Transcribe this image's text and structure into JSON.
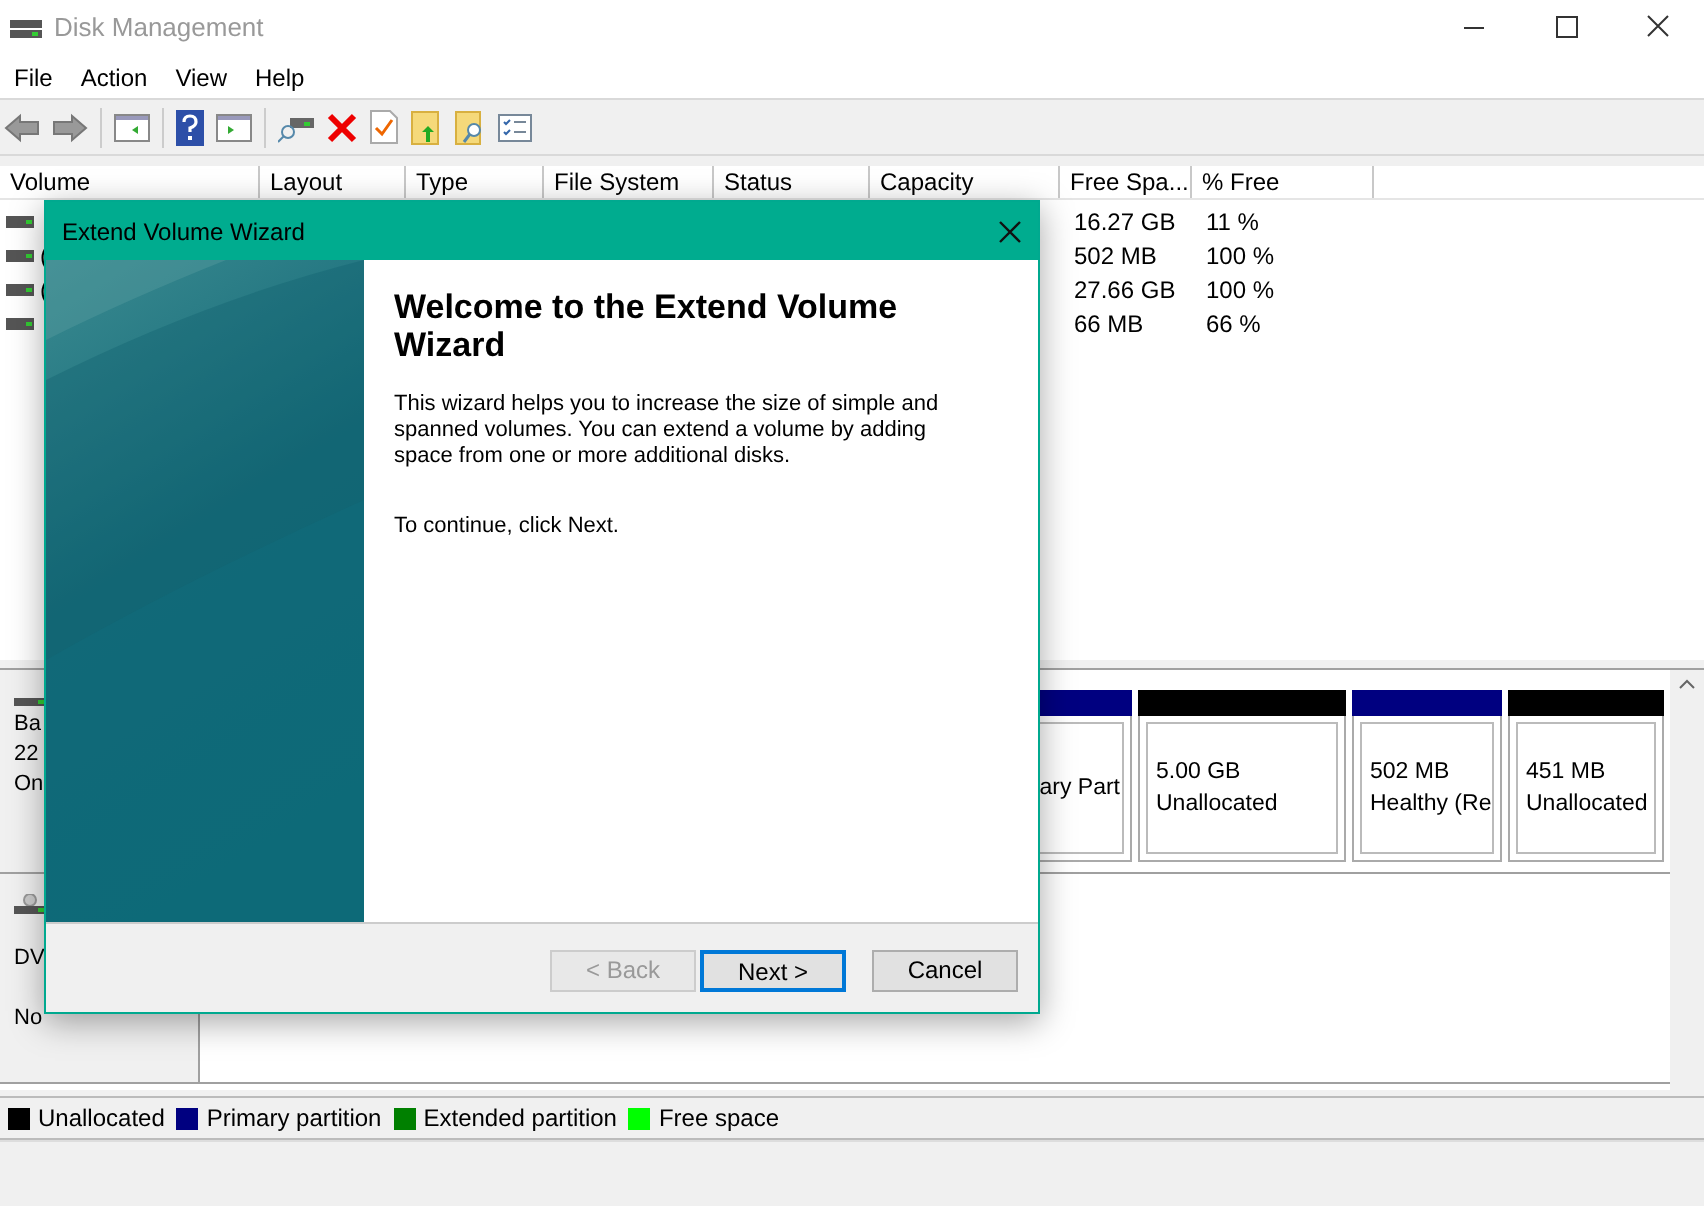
{
  "window": {
    "title": "Disk Management"
  },
  "menu": [
    "File",
    "Action",
    "View",
    "Help"
  ],
  "volumes": {
    "columns": [
      "Volume",
      "Layout",
      "Type",
      "File System",
      "Status",
      "Capacity",
      "Free Spa...",
      "% Free"
    ],
    "rows": [
      {
        "free_space": "16.27 GB",
        "percent_free": "11 %"
      },
      {
        "volume": "(",
        "free_space": "502 MB",
        "percent_free": "100 %"
      },
      {
        "volume": "(",
        "free_space": "27.66 GB",
        "percent_free": "100 %"
      },
      {
        "free_space": "66 MB",
        "percent_free": "66 %"
      }
    ]
  },
  "disks": [
    {
      "kind": "disk",
      "lines": [
        "Ba",
        "22",
        "On"
      ],
      "partitions": [
        {
          "color": "#000080",
          "lines": [
            "ary Part"
          ]
        },
        {
          "color": "#000000",
          "lines": [
            "5.00 GB",
            "Unallocated"
          ]
        },
        {
          "color": "#000080",
          "lines": [
            "502 MB",
            "Healthy (Re"
          ]
        },
        {
          "color": "#000000",
          "lines": [
            "451 MB",
            "Unallocated"
          ]
        }
      ]
    },
    {
      "kind": "cdrom",
      "lines": [
        "DV",
        "No"
      ]
    }
  ],
  "legend": [
    {
      "label": "Unallocated",
      "color": "#000000"
    },
    {
      "label": "Primary partition",
      "color": "#000080"
    },
    {
      "label": "Extended partition",
      "color": "#008000"
    },
    {
      "label": "Free space",
      "color": "#00ff00"
    }
  ],
  "dialog": {
    "title": "Extend Volume Wizard",
    "heading": "Welcome to the Extend Volume Wizard",
    "paragraphs": [
      "This wizard helps you to increase the size of simple and spanned volumes. You can extend a volume by adding space from one or more additional disks.",
      "To continue, click Next."
    ],
    "buttons": [
      {
        "label": "< Back",
        "disabled": true,
        "default": false
      },
      {
        "label": "Next >",
        "disabled": false,
        "default": true
      },
      {
        "label": "Cancel",
        "disabled": false,
        "default": false
      }
    ]
  }
}
